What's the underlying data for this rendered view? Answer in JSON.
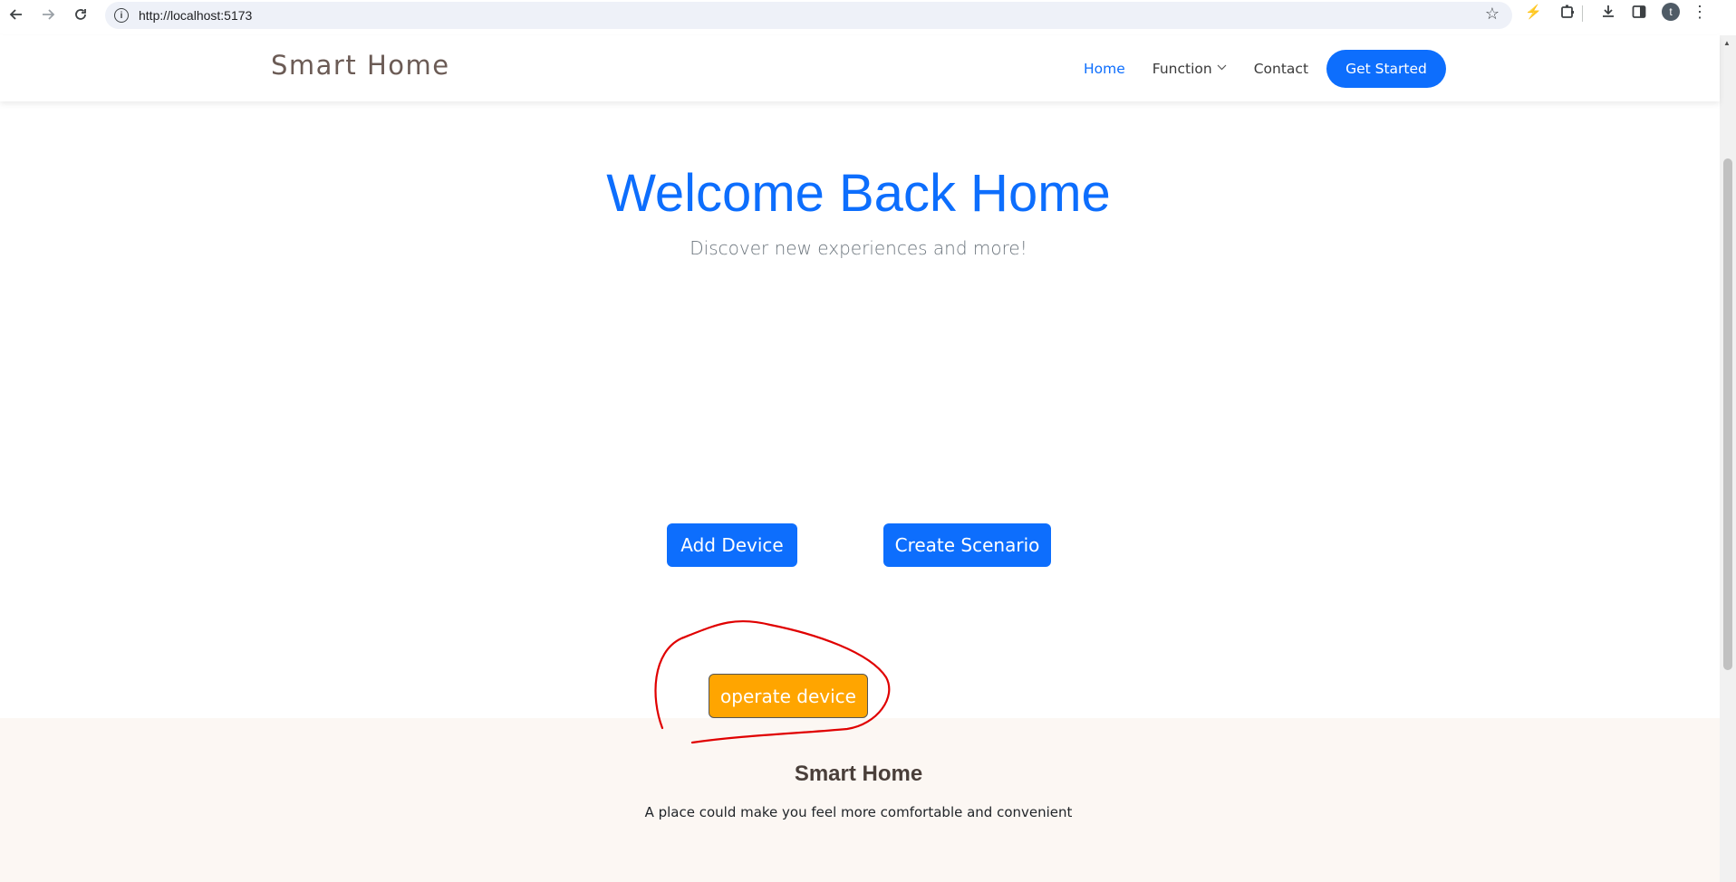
{
  "browser": {
    "url": "http://localhost:5173"
  },
  "nav": {
    "brand": "Smart Home",
    "links": [
      {
        "label": "Home",
        "active": true
      },
      {
        "label": "Function",
        "dropdown": true
      },
      {
        "label": "Contact"
      }
    ],
    "cta": "Get Started"
  },
  "hero": {
    "title": "Welcome Back Home",
    "subtitle": "Discover new experiences and more!"
  },
  "actions": {
    "add_device": "Add Device",
    "create_scenario": "Create Scenario",
    "operate_device": "operate device"
  },
  "footer": {
    "title": "Smart Home",
    "text": "A place could make you feel more comfortable and convenient"
  },
  "colors": {
    "accent": "#0d6efd",
    "operate": "#ffa500",
    "annotation": "#e00000",
    "footer_bg": "#fcf7f3"
  },
  "icons": [
    "back-icon",
    "forward-icon",
    "reload-icon",
    "site-info-icon",
    "star-icon",
    "performance-icon",
    "extensions-icon",
    "download-icon",
    "side-panel-icon",
    "profile-avatar",
    "menu-icon",
    "chevron-down-icon"
  ]
}
